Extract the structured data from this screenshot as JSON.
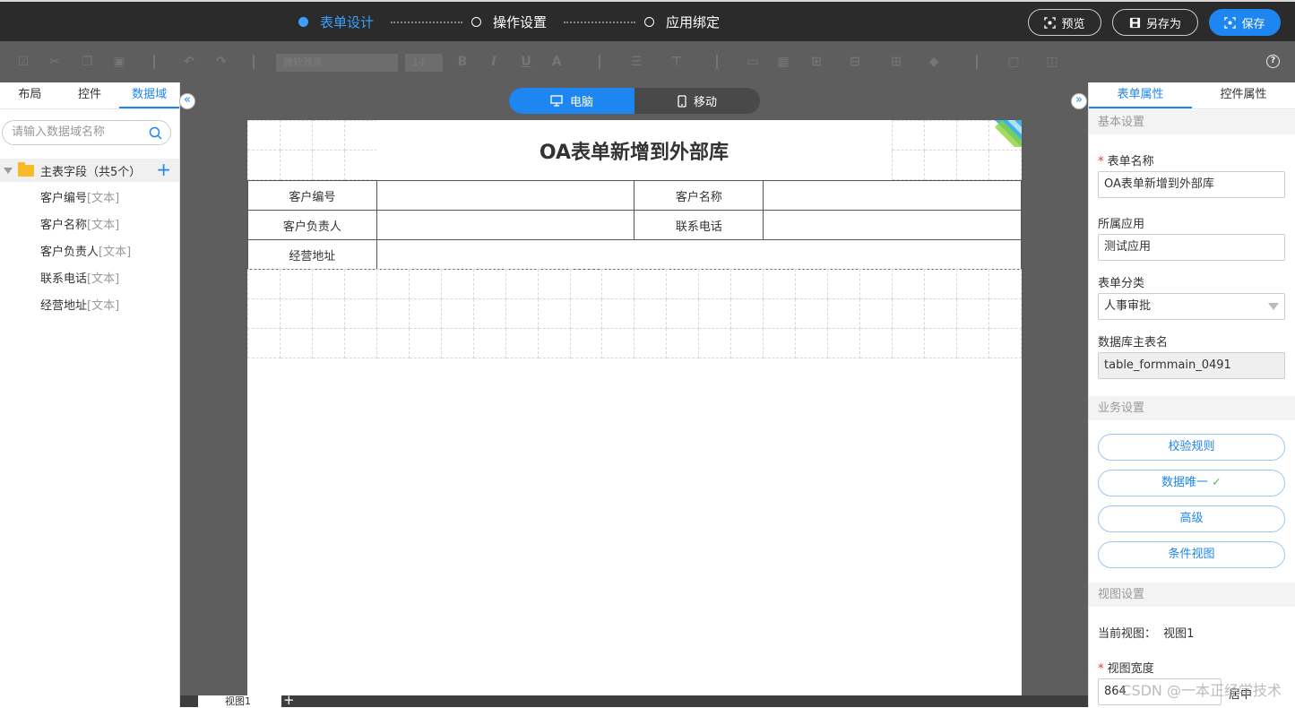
{
  "steps": [
    {
      "label": "表单设计"
    },
    {
      "label": "操作设置"
    },
    {
      "label": "应用绑定"
    }
  ],
  "actions": {
    "preview": "预览",
    "save_as": "另存为",
    "save": "保存"
  },
  "toolbar": {
    "font_family": "微软雅黑",
    "font_size": "14"
  },
  "left_panel": {
    "tabs": [
      "布局",
      "控件",
      "数据域"
    ],
    "search_placeholder": "请输入数据域名称",
    "tree_root": "主表字段（共5个）",
    "fields": [
      {
        "name": "客户编号",
        "type": "[文本]"
      },
      {
        "name": "客户名称",
        "type": "[文本]"
      },
      {
        "name": "客户负责人",
        "type": "[文本]"
      },
      {
        "name": "联系电话",
        "type": "[文本]"
      },
      {
        "name": "经营地址",
        "type": "[文本]"
      }
    ]
  },
  "device": {
    "pc": "电脑",
    "mobile": "移动"
  },
  "form": {
    "title": "OA表单新增到外部库",
    "rows": [
      [
        "客户编号",
        "",
        "客户名称",
        ""
      ],
      [
        "客户负责人",
        "",
        "联系电话",
        ""
      ],
      [
        "经营地址",
        ""
      ]
    ]
  },
  "view_tabs": {
    "view": "视图1",
    "add": "+"
  },
  "right_panel": {
    "tabs": [
      "表单属性",
      "控件属性"
    ],
    "basic_section": "基本设置",
    "form_name_label": "表单名称",
    "form_name_value": "OA表单新增到外部库",
    "app_label": "所属应用",
    "app_value": "测试应用",
    "category_label": "表单分类",
    "category_value": "人事审批",
    "db_label": "数据库主表名",
    "db_value": "table_formmain_0491",
    "business_section": "业务设置",
    "buttons": [
      "校验规则",
      "数据唯一",
      "高级",
      "条件视图"
    ],
    "view_section": "视图设置",
    "current_view_label": "当前视图：",
    "current_view_value": "视图1",
    "view_width_label": "视图宽度",
    "view_width_value": "864",
    "align_value": "居中"
  },
  "watermark": "CSDN @一本正经学技术",
  "colors": {
    "accent": "#1e86f0",
    "topbar": "#2b2b2b",
    "workspace": "#5e5e5e",
    "success": "#5cb85c"
  }
}
